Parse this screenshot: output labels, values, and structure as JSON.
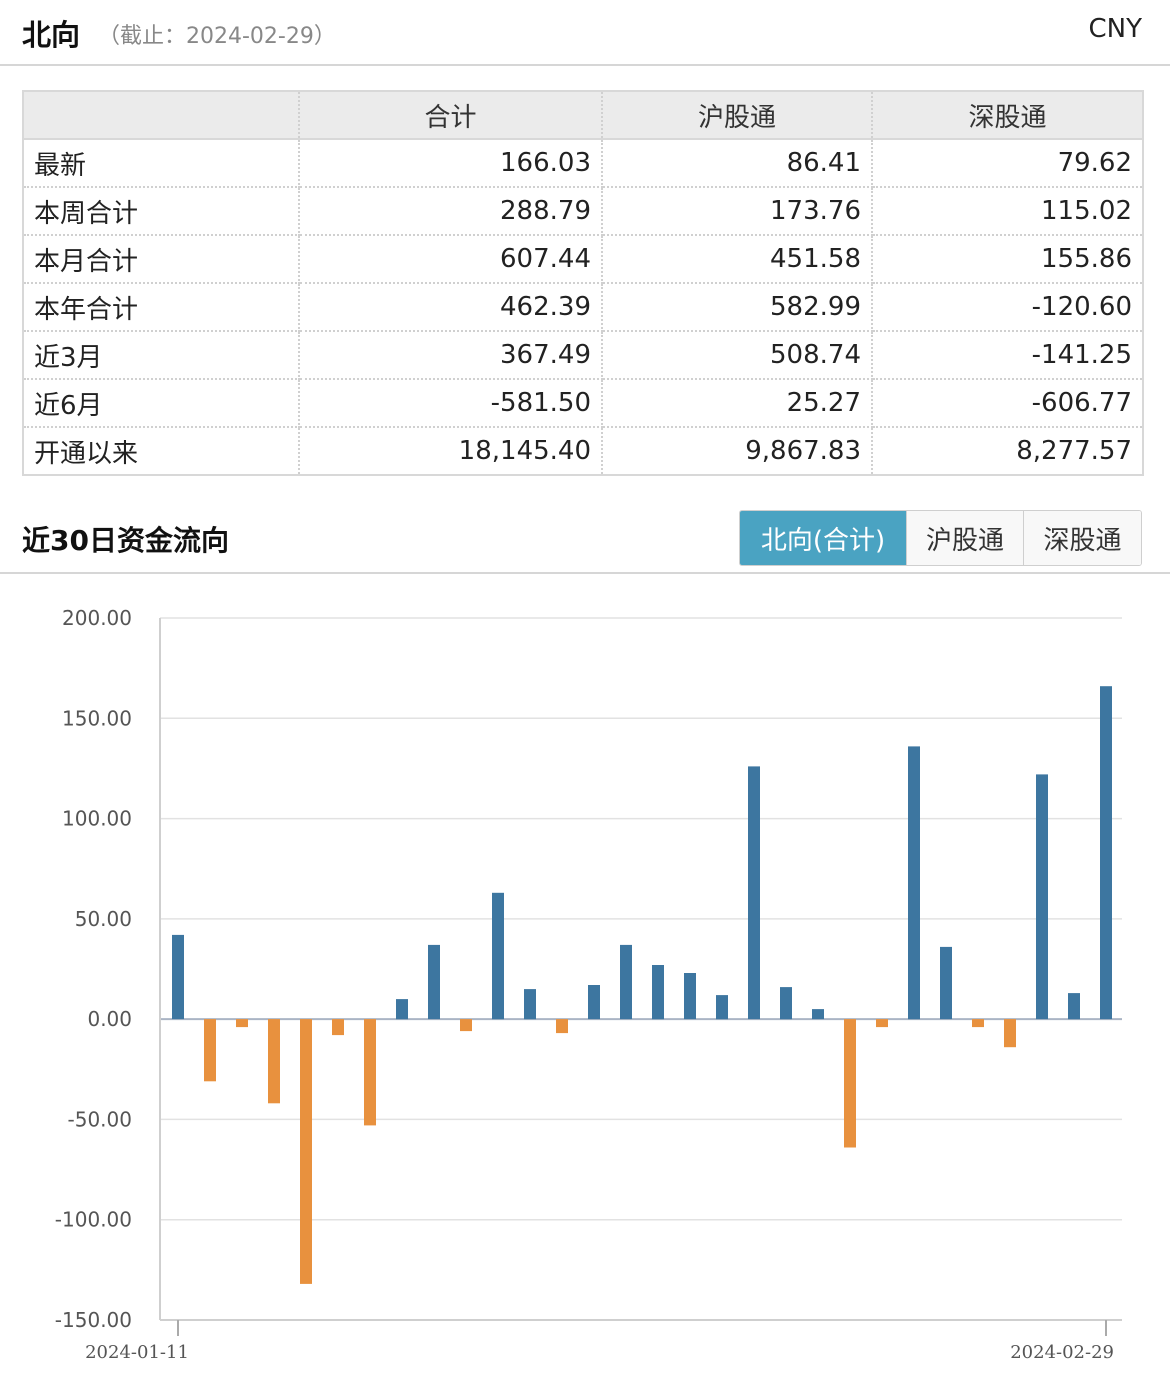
{
  "header": {
    "title": "北向",
    "subtitle": "（截止：2024-02-29）",
    "currency": "CNY"
  },
  "table": {
    "columns": [
      "",
      "合计",
      "沪股通",
      "深股通"
    ],
    "rows": [
      {
        "label": "最新",
        "total": "166.03",
        "sh": "86.41",
        "sz": "79.62"
      },
      {
        "label": "本周合计",
        "total": "288.79",
        "sh": "173.76",
        "sz": "115.02"
      },
      {
        "label": "本月合计",
        "total": "607.44",
        "sh": "451.58",
        "sz": "155.86"
      },
      {
        "label": "本年合计",
        "total": "462.39",
        "sh": "582.99",
        "sz": "-120.60"
      },
      {
        "label": "近3月",
        "total": "367.49",
        "sh": "508.74",
        "sz": "-141.25"
      },
      {
        "label": "近6月",
        "total": "-581.50",
        "sh": "25.27",
        "sz": "-606.77"
      },
      {
        "label": "开通以来",
        "total": "18,145.40",
        "sh": "9,867.83",
        "sz": "8,277.57"
      }
    ]
  },
  "section": {
    "title": "近30日资金流向",
    "tabs": [
      {
        "label": "北向(合计)",
        "active": true
      },
      {
        "label": "沪股通",
        "active": false
      },
      {
        "label": "深股通",
        "active": false
      }
    ]
  },
  "colors": {
    "positive": "#3d76a0",
    "negative": "#e8913e",
    "active_tab": "#4aa3c2"
  },
  "chart_data": {
    "type": "bar",
    "title": "",
    "xlabel": "",
    "ylabel": "",
    "ylim": [
      -150,
      200
    ],
    "yticks": [
      "200.00",
      "150.00",
      "100.00",
      "50.00",
      "0.00",
      "-50.00",
      "-100.00",
      "-150.00"
    ],
    "x_tick_labels": [
      "2024-01-11",
      "2024-02-29"
    ],
    "x_first": "2024-01-11",
    "x_last": "2024-02-29",
    "grid": true,
    "values": [
      42,
      -31,
      -4,
      -42,
      -132,
      -8,
      -53,
      10,
      37,
      -6,
      63,
      15,
      -7,
      17,
      37,
      27,
      23,
      12,
      126,
      16,
      5,
      -64,
      -4,
      136,
      36,
      -4,
      -14,
      122,
      13,
      166
    ]
  }
}
